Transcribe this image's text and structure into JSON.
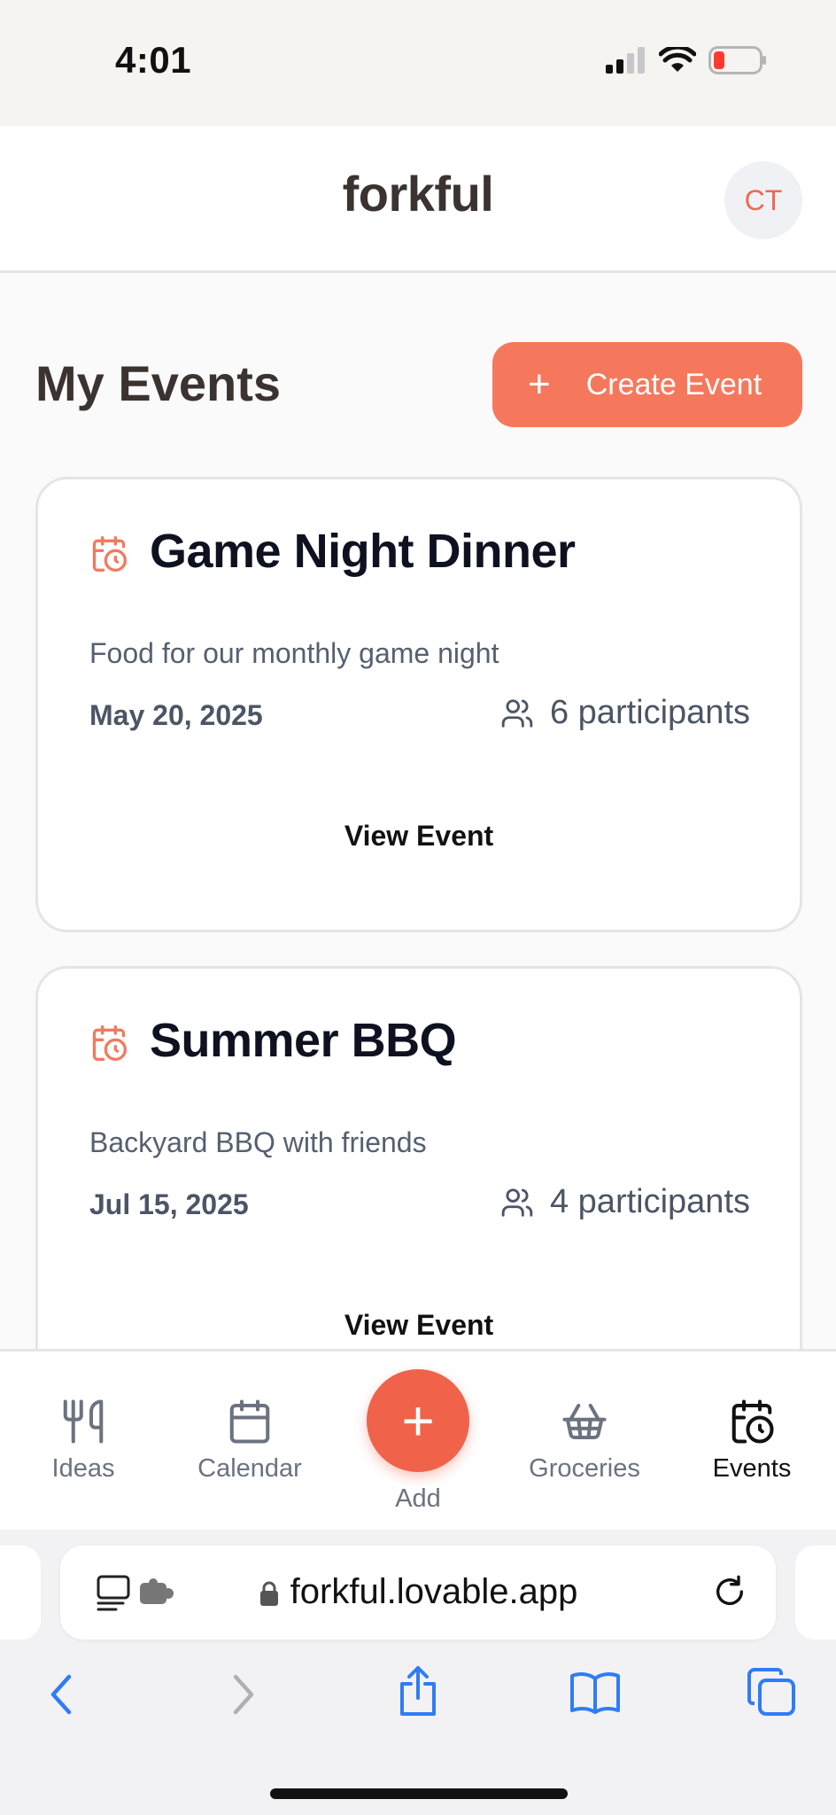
{
  "status_bar": {
    "time": "4:01"
  },
  "header": {
    "brand": "forkful",
    "avatar_initials": "CT"
  },
  "main": {
    "title": "My Events",
    "create_button_label": "Create Event",
    "events": [
      {
        "title": "Game Night Dinner",
        "description": "Food for our monthly game night",
        "date": "May 20, 2025",
        "participants": "6 participants",
        "view_label": "View Event"
      },
      {
        "title": "Summer BBQ",
        "description": "Backyard BBQ with friends",
        "date": "Jul 15, 2025",
        "participants": "4 participants",
        "view_label": "View Event"
      }
    ]
  },
  "bottom_nav": {
    "items": [
      {
        "label": "Ideas",
        "icon": "utensils-icon"
      },
      {
        "label": "Calendar",
        "icon": "calendar-icon"
      },
      {
        "label": "Add",
        "icon": "plus-icon"
      },
      {
        "label": "Groceries",
        "icon": "basket-icon"
      },
      {
        "label": "Events",
        "icon": "calendar-clock-icon",
        "active": true
      }
    ]
  },
  "browser": {
    "url": "forkful.lovable.app"
  },
  "colors": {
    "accent": "#f5785d",
    "add_button": "#f0624a",
    "text_dark": "#3b3330",
    "ios_blue": "#2f7cf6"
  }
}
